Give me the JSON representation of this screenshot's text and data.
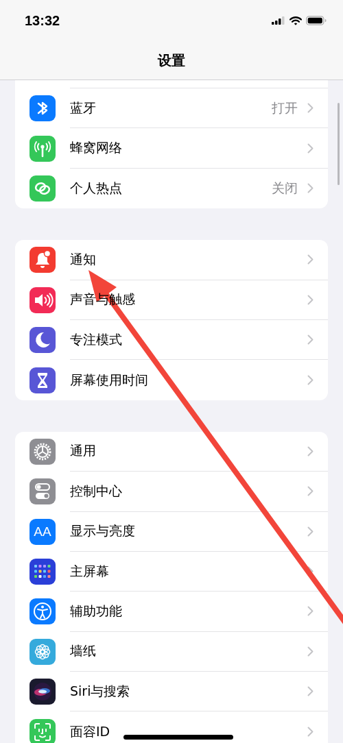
{
  "status_bar": {
    "time": "13:32"
  },
  "nav": {
    "title": "设置"
  },
  "groups": [
    {
      "cut_top": true,
      "items": [
        {
          "kind": "bluetooth",
          "label": "蓝牙",
          "value": "打开"
        },
        {
          "kind": "cellular",
          "label": "蜂窝网络"
        },
        {
          "kind": "hotspot",
          "label": "个人热点",
          "value": "关闭"
        }
      ]
    },
    {
      "items": [
        {
          "kind": "notifications",
          "label": "通知"
        },
        {
          "kind": "sounds",
          "label": "声音与触感"
        },
        {
          "kind": "focus",
          "label": "专注模式"
        },
        {
          "kind": "screentime",
          "label": "屏幕使用时间"
        }
      ]
    },
    {
      "items": [
        {
          "kind": "general",
          "label": "通用"
        },
        {
          "kind": "control",
          "label": "控制中心"
        },
        {
          "kind": "display",
          "label": "显示与亮度",
          "icon_text": "AA"
        },
        {
          "kind": "homescreen",
          "label": "主屏幕"
        },
        {
          "kind": "accessibility",
          "label": "辅助功能"
        },
        {
          "kind": "wallpaper",
          "label": "墙纸"
        },
        {
          "kind": "siri",
          "label": "Siri与搜索"
        },
        {
          "kind": "faceid",
          "label": "面容ID"
        }
      ]
    }
  ],
  "annotation": {
    "kind": "arrow"
  }
}
